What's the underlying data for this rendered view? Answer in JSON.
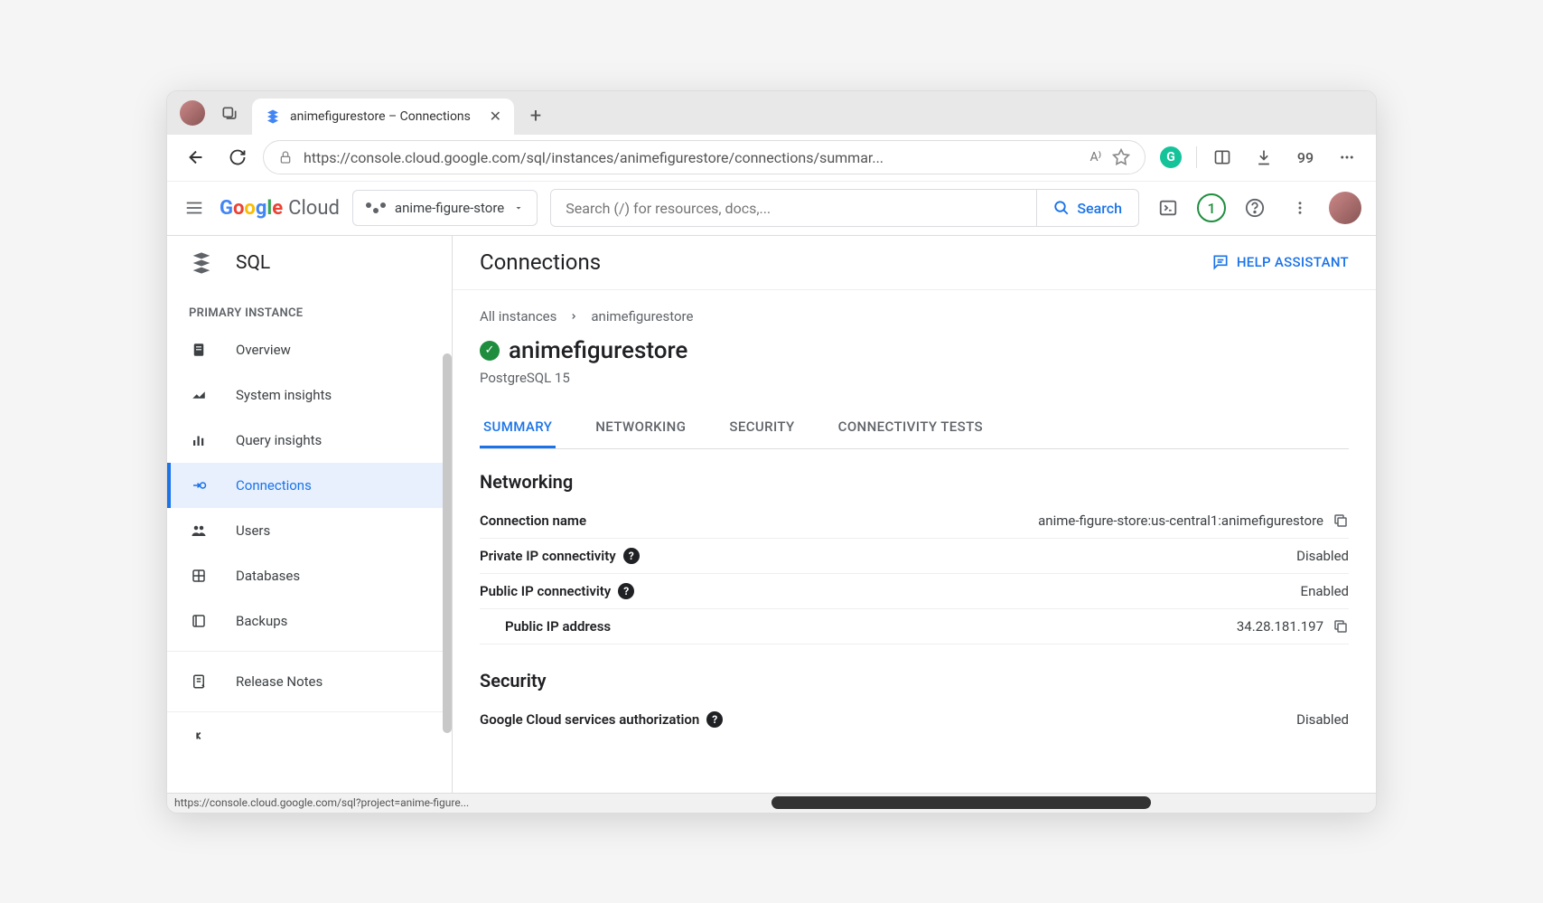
{
  "browser": {
    "tab_title": "animefigurestore – Connections",
    "url_display": "https://console.cloud.google.com/sql/instances/animefigurestore/connections/summar...",
    "reader_aa": "A⁹⁹",
    "quotes": "99",
    "status_text": "https://console.cloud.google.com/sql?project=anime-figure..."
  },
  "header": {
    "logo_text": "Cloud",
    "project_name": "anime-figure-store",
    "search_placeholder": "Search (/) for resources, docs,...",
    "search_btn": "Search",
    "notif_count": "1"
  },
  "sidebar": {
    "service": "SQL",
    "section": "PRIMARY INSTANCE",
    "items": [
      {
        "label": "Overview"
      },
      {
        "label": "System insights"
      },
      {
        "label": "Query insights"
      },
      {
        "label": "Connections"
      },
      {
        "label": "Users"
      },
      {
        "label": "Databases"
      },
      {
        "label": "Backups"
      },
      {
        "label": "Release Notes"
      }
    ]
  },
  "page": {
    "title": "Connections",
    "help_assistant": "HELP ASSISTANT",
    "breadcrumb_all": "All instances",
    "breadcrumb_current": "animefigurestore",
    "instance_name": "animefigurestore",
    "instance_type": "PostgreSQL 15",
    "tabs": [
      {
        "label": "SUMMARY"
      },
      {
        "label": "NETWORKING"
      },
      {
        "label": "SECURITY"
      },
      {
        "label": "CONNECTIVITY TESTS"
      }
    ],
    "networking": {
      "title": "Networking",
      "conn_name_label": "Connection name",
      "conn_name_value": "anime-figure-store:us-central1:animefigurestore",
      "private_ip_label": "Private IP connectivity",
      "private_ip_value": "Disabled",
      "public_ip_label": "Public IP connectivity",
      "public_ip_value": "Enabled",
      "public_ip_addr_label": "Public IP address",
      "public_ip_addr_value": "34.28.181.197"
    },
    "security": {
      "title": "Security",
      "gc_auth_label": "Google Cloud services authorization",
      "gc_auth_value": "Disabled"
    }
  }
}
